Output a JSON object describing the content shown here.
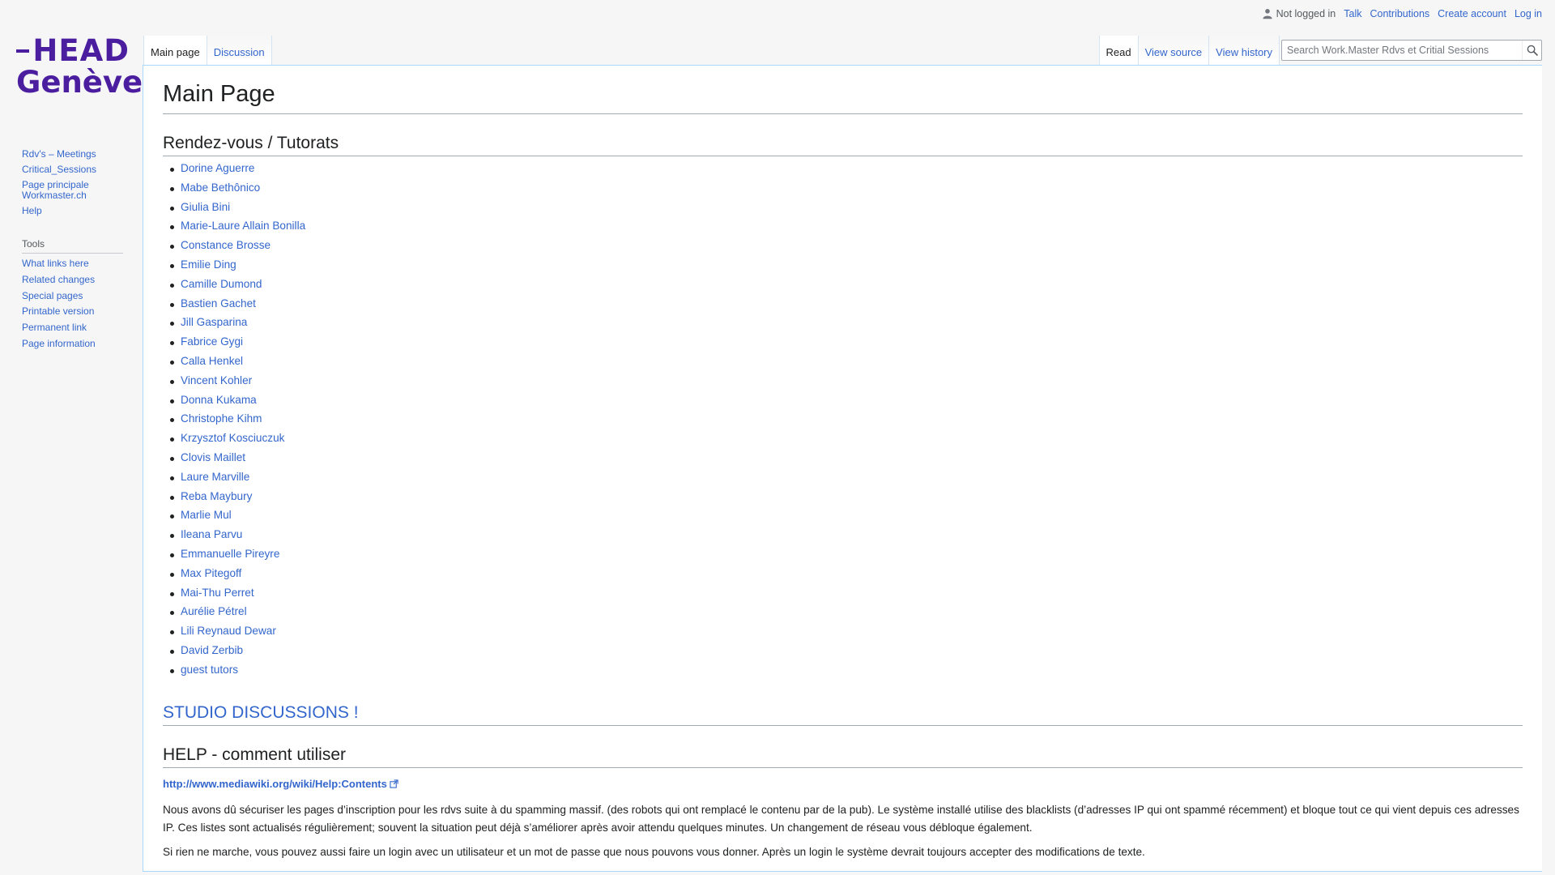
{
  "personal": {
    "not_logged_in": "Not logged in",
    "talk": "Talk",
    "contributions": "Contributions",
    "create_account": "Create account",
    "log_in": "Log in"
  },
  "logo": {
    "line1": "HEAD",
    "line2": "Genève",
    "color": "#4b1ea0"
  },
  "sidebar": {
    "nav": [
      "Rdv's – Meetings",
      "Critical_Sessions",
      "Page principale Workmaster.ch",
      "Help"
    ],
    "tools_heading": "Tools",
    "tools": [
      "What links here",
      "Related changes",
      "Special pages",
      "Printable version",
      "Permanent link",
      "Page information"
    ]
  },
  "tabs": {
    "main_page": "Main page",
    "discussion": "Discussion",
    "read": "Read",
    "view_source": "View source",
    "view_history": "View history"
  },
  "search": {
    "placeholder": "Search Work.Master Rdvs et Critial Sessions"
  },
  "content": {
    "title": "Main Page",
    "section1": "Rendez-vous / Tutorats",
    "tutors": [
      "Dorine Aguerre",
      "Mabe Bethônico",
      "Giulia Bini",
      "Marie-Laure Allain Bonilla",
      "Constance Brosse",
      "Emilie Ding",
      "Camille Dumond",
      "Bastien Gachet",
      "Jill Gasparina",
      "Fabrice Gygi",
      "Calla Henkel",
      "Vincent Kohler",
      "Donna Kukama",
      "Christophe Kihm",
      "Krzysztof Kosciuczuk",
      "Clovis Maillet",
      "Laure Marville",
      "Reba Maybury",
      "Marlie Mul",
      "Ileana Parvu",
      "Emmanuelle Pireyre",
      "Max Pitegoff",
      "Mai-Thu Perret",
      "Aurélie Pétrel",
      "Lili Reynaud Dewar",
      "David Zerbib",
      "guest tutors"
    ],
    "section2": "STUDIO DISCUSSIONS !",
    "section3": "HELP - comment utiliser",
    "help_link": "http://www.mediawiki.org/wiki/Help:Contents",
    "para1": "Nous avons dû sécuriser les pages d’inscription pour les rdvs suite à du spamming massif. (des robots qui ont remplacé le contenu par de la pub). Le système installé utilise des blacklists (d’adresses IP qui ont spammé récemment) et bloque tout ce qui vient depuis ces adresses IP. Ces listes sont actualisés régulièrement; souvent la situation peut déjà s’améliorer après avoir attendu quelques minutes. Un changement de réseau vous débloque également.",
    "para2": "Si rien ne marche, vous pouvez aussi faire un login avec un utilisateur et un mot de passe que nous pouvons vous donner. Après un login le système devrait toujours accepter des modifications de texte."
  }
}
